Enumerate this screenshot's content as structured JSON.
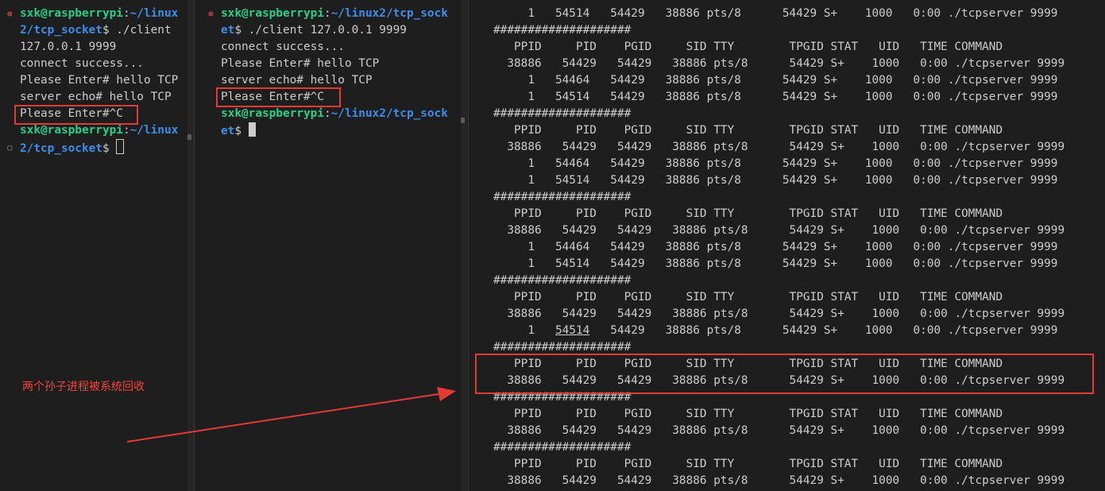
{
  "colors": {
    "background": "#1e1e1e",
    "text": "#cccccc",
    "prompt_user": "#23d18b",
    "prompt_path": "#3b8eea",
    "annotation": "#e53935"
  },
  "pane1": {
    "lines": [
      {
        "marker": "error",
        "user": "sxk@raspberrypi",
        "sep": ":",
        "path": "~/linux"
      },
      {
        "path": "2/tcp_socket",
        "tail": "$ ./client"
      },
      {
        "text": "127.0.0.1 9999"
      },
      {
        "text": "connect success..."
      },
      {
        "text": "Please Enter# hello TCP"
      },
      {
        "text": "server echo# hello TCP"
      },
      {
        "text": "Please Enter#^C"
      },
      {
        "user": "sxk@raspberrypi",
        "sep": ":",
        "path": "~/linux"
      },
      {
        "marker": "ok",
        "path": "2/tcp_socket",
        "tail": "$ "
      }
    ]
  },
  "pane2": {
    "lines": [
      {
        "marker": "error",
        "user": "sxk@raspberrypi",
        "sep": ":",
        "path": "~/linux2/tcp_sock"
      },
      {
        "path": "et",
        "tail": "$ ./client 127.0.0.1 9999"
      },
      {
        "text": "connect success..."
      },
      {
        "text": "Please Enter# hello TCP"
      },
      {
        "text": "server echo# hello TCP"
      },
      {
        "text": "Please Enter#^C"
      },
      {
        "user": "sxk@raspberrypi",
        "sep": ":",
        "path": "~/linux2/tcp_sock"
      },
      {
        "path": "et",
        "tail": "$ "
      }
    ]
  },
  "pane3": {
    "lines": [
      "     1   54514   54429   38886 pts/8      54429 S+    1000   0:00 ./tcpserver 9999",
      "####################",
      "   PPID     PID    PGID     SID TTY        TPGID STAT   UID   TIME COMMAND",
      "  38886   54429   54429   38886 pts/8      54429 S+    1000   0:00 ./tcpserver 9999",
      "     1   54464   54429   38886 pts/8      54429 S+    1000   0:00 ./tcpserver 9999",
      "     1   54514   54429   38886 pts/8      54429 S+    1000   0:00 ./tcpserver 9999",
      "####################",
      "   PPID     PID    PGID     SID TTY        TPGID STAT   UID   TIME COMMAND",
      "  38886   54429   54429   38886 pts/8      54429 S+    1000   0:00 ./tcpserver 9999",
      "     1   54464   54429   38886 pts/8      54429 S+    1000   0:00 ./tcpserver 9999",
      "     1   54514   54429   38886 pts/8      54429 S+    1000   0:00 ./tcpserver 9999",
      "####################",
      "   PPID     PID    PGID     SID TTY        TPGID STAT   UID   TIME COMMAND",
      "  38886   54429   54429   38886 pts/8      54429 S+    1000   0:00 ./tcpserver 9999",
      "     1   54464   54429   38886 pts/8      54429 S+    1000   0:00 ./tcpserver 9999",
      "     1   54514   54429   38886 pts/8      54429 S+    1000   0:00 ./tcpserver 9999",
      "####################",
      "   PPID     PID    PGID     SID TTY        TPGID STAT   UID   TIME COMMAND",
      "  38886   54429   54429   38886 pts/8      54429 S+    1000   0:00 ./tcpserver 9999",
      "     1   54514   54429   38886 pts/8      54429 S+    1000   0:00 ./tcpserver 9999",
      "####################",
      "   PPID     PID    PGID     SID TTY        TPGID STAT   UID   TIME COMMAND",
      "  38886   54429   54429   38886 pts/8      54429 S+    1000   0:00 ./tcpserver 9999",
      "####################",
      "   PPID     PID    PGID     SID TTY        TPGID STAT   UID   TIME COMMAND",
      "  38886   54429   54429   38886 pts/8      54429 S+    1000   0:00 ./tcpserver 9999",
      "####################",
      "   PPID     PID    PGID     SID TTY        TPGID STAT   UID   TIME COMMAND",
      "  38886   54429   54429   38886 pts/8      54429 S+    1000   0:00 ./tcpserver 9999"
    ]
  },
  "annotation": {
    "text": "两个孙子进程被系统回收"
  }
}
